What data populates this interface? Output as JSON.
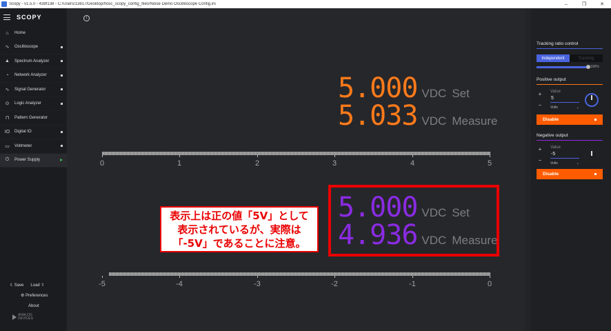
{
  "window": {
    "title": "Scopy - v1.5.0 - 438f138 - C:/Users/13817/Desktop/hosc_scopy_config_files/Noise Demo Oscilloscope Config.ini",
    "minimize": "–",
    "maximize": "❐",
    "close": "✕"
  },
  "sidebar": {
    "logo": "SCOPY",
    "home": "Home",
    "items": [
      {
        "label": "Oscilloscope",
        "icon": "∿"
      },
      {
        "label": "Spectrum Analyzer",
        "icon": "▲"
      },
      {
        "label": "Network Analyzer",
        "icon": "◔"
      },
      {
        "label": "Signal Generator",
        "icon": "∿"
      },
      {
        "label": "Logic Analyzer",
        "icon": "⊙"
      },
      {
        "label": "Pattern Generator",
        "icon": "⊓"
      },
      {
        "label": "Digital IO",
        "icon": "IO"
      },
      {
        "label": "Voltmeter",
        "icon": "▭"
      },
      {
        "label": "Power Supply",
        "icon": "⏻"
      }
    ],
    "save": "Save",
    "load": "Load",
    "preferences": "Preferences",
    "about": "About",
    "brand_top": "ANALOG",
    "brand_bottom": "DEVICES"
  },
  "positive_readout": {
    "set_value": "5.000",
    "set_unit": "VDC",
    "set_label": "Set",
    "measure_value": "5.033",
    "measure_unit": "VDC",
    "measure_label": "Measure",
    "scale_labels": [
      "0",
      "1",
      "2",
      "3",
      "4",
      "5"
    ]
  },
  "negative_readout": {
    "set_value": "5.000",
    "set_unit": "VDC",
    "set_label": "Set",
    "measure_value": "4.936",
    "measure_unit": "VDC",
    "measure_label": "Measure",
    "scale_labels": [
      "-5",
      "-4",
      "-3",
      "-2",
      "-1",
      "0"
    ]
  },
  "annotation": {
    "line1": "表示上は正の値「5V」として",
    "line2": "表示されているが、実際は",
    "line3": "「-5V」であることに注意。"
  },
  "right_panel": {
    "tracking_title": "Tracking ratio control",
    "mode_independent": "Independent",
    "mode_tracking": "Tracking",
    "tracking_ratio": 100,
    "tracking_ratio_text": "100%",
    "positive": {
      "title": "Positive output",
      "value_label": "Value",
      "value": "5",
      "unit": "Volts",
      "disable": "Disable"
    },
    "negative": {
      "title": "Negative output",
      "value_label": "Value",
      "value": "-5",
      "unit": "Volts",
      "disable": "Disable"
    },
    "plus": "+",
    "minus": "−",
    "chevron": "⌄"
  },
  "colors": {
    "positive_accent": "#ff7a1a",
    "negative_accent": "#8a2be2",
    "highlight": "#ea0000",
    "button": "#ff5c00",
    "selected": "#4a64e0"
  }
}
